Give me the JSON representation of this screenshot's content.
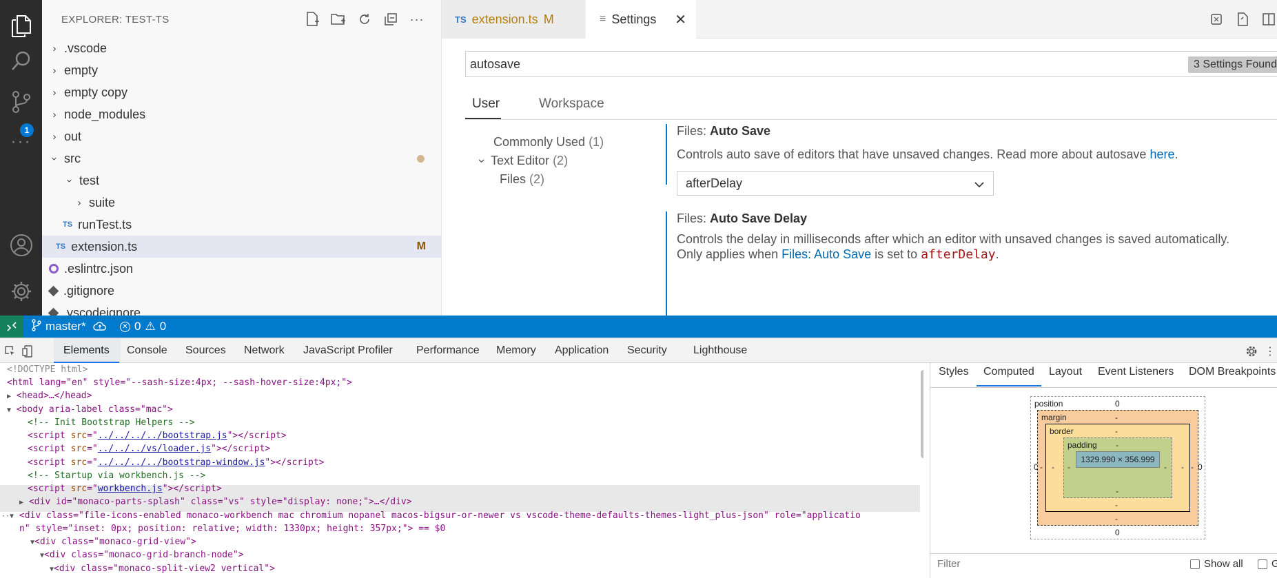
{
  "explorer": {
    "title": "EXPLORER: TEST-TS",
    "items": [
      {
        "label": ".vscode",
        "type": "folder",
        "expanded": false,
        "depth": 0
      },
      {
        "label": "empty",
        "type": "folder",
        "expanded": false,
        "depth": 0
      },
      {
        "label": "empty copy",
        "type": "folder",
        "expanded": false,
        "depth": 0
      },
      {
        "label": "node_modules",
        "type": "folder",
        "expanded": false,
        "depth": 0
      },
      {
        "label": "out",
        "type": "folder",
        "expanded": false,
        "depth": 0
      },
      {
        "label": "src",
        "type": "folder",
        "expanded": true,
        "depth": 0
      },
      {
        "label": "test",
        "type": "folder",
        "expanded": true,
        "depth": 1
      },
      {
        "label": "suite",
        "type": "folder",
        "expanded": false,
        "depth": 2
      },
      {
        "label": "runTest.ts",
        "type": "ts",
        "depth": 2
      },
      {
        "label": "extension.ts",
        "type": "ts",
        "depth": 1,
        "status": "M"
      },
      {
        "label": ".eslintrc.json",
        "type": "eslint",
        "depth": 0
      },
      {
        "label": ".gitignore",
        "type": "git",
        "depth": 0
      },
      {
        "label": ".vscodeignore",
        "type": "git",
        "depth": 0
      }
    ]
  },
  "activity": {
    "scm_badge": "1"
  },
  "tabs": {
    "file_tab": {
      "icon": "TS",
      "label": "extension.ts",
      "status": "M"
    },
    "settings_tab": {
      "label": "Settings"
    }
  },
  "settings": {
    "search_value": "autosave",
    "found": "3 Settings Found",
    "scopes": {
      "user": "User",
      "workspace": "Workspace"
    },
    "toc": [
      {
        "label": "Commonly Used",
        "count": "(1)"
      },
      {
        "label": "Text Editor",
        "count": "(2)"
      },
      {
        "label": "Files",
        "count": "(2)"
      }
    ],
    "auto_save": {
      "category": "Files: ",
      "name": "Auto Save",
      "description": "Controls auto save of editors that have unsaved changes. Read more about autosave ",
      "link": "here",
      "link_suffix": ".",
      "value": "afterDelay"
    },
    "auto_save_delay": {
      "category": "Files: ",
      "name": "Auto Save Delay",
      "description": "Controls the delay in milliseconds after which an editor with unsaved changes is saved automatically.",
      "line2_prefix": "Only applies when ",
      "line2_link": "Files: Auto Save",
      "line2_mid": " is set to ",
      "line2_code": "afterDelay",
      "line2_suffix": "."
    }
  },
  "statusbar": {
    "branch": "master*",
    "errors": "0",
    "warnings": "0"
  },
  "devtools": {
    "tabs": [
      "Elements",
      "Console",
      "Sources",
      "Network",
      "JavaScript Profiler",
      "Performance",
      "Memory",
      "Application",
      "Security",
      "Lighthouse"
    ],
    "side_tabs": [
      "Styles",
      "Computed",
      "Layout",
      "Event Listeners",
      "DOM Breakpoints"
    ],
    "box_model": {
      "position": "position",
      "position_value": "0",
      "margin": "margin",
      "border": "border",
      "padding": "padding",
      "dash": "-",
      "zero": "0",
      "content": "1329.990 × 356.999"
    },
    "filter_placeholder": "Filter",
    "show_all": "Show all",
    "group": "G",
    "dom": {
      "doctype": "<!DOCTYPE html>",
      "html_open": "<html lang=\"en\" style=\"--sash-size:4px; --sash-hover-size:4px;\">",
      "head": "<head>…</head>",
      "body_open": "<body aria-label class=\"mac\">",
      "comment1": "<!-- Init Bootstrap Helpers -->",
      "script1_src": "../../../../bootstrap.js",
      "script2_src": "../../../vs/loader.js",
      "script3_src": "../../../../bootstrap-window.js",
      "comment2": "<!-- Startup via workbench.js -->",
      "script4_src": "workbench.js",
      "splash": "<div id=\"monaco-parts-splash\" class=\"vs\" style=\"display: none;\">…</div>",
      "workbench_line1": "<div class=\"file-icons-enabled monaco-workbench mac chromium nopanel macos-bigsur-or-newer vs vscode-theme-defaults-themes-light_plus-json\" role=\"applicatio",
      "workbench_line2": "n\" style=\"inset: 0px; position: relative; width: 1330px; height: 357px;\"> == $0",
      "grid_view": "<div class=\"monaco-grid-view\">",
      "grid_branch": "<div class=\"monaco-grid-branch-node\">",
      "split_view": "<div class=\"monaco-split-view2 vertical\">"
    }
  }
}
